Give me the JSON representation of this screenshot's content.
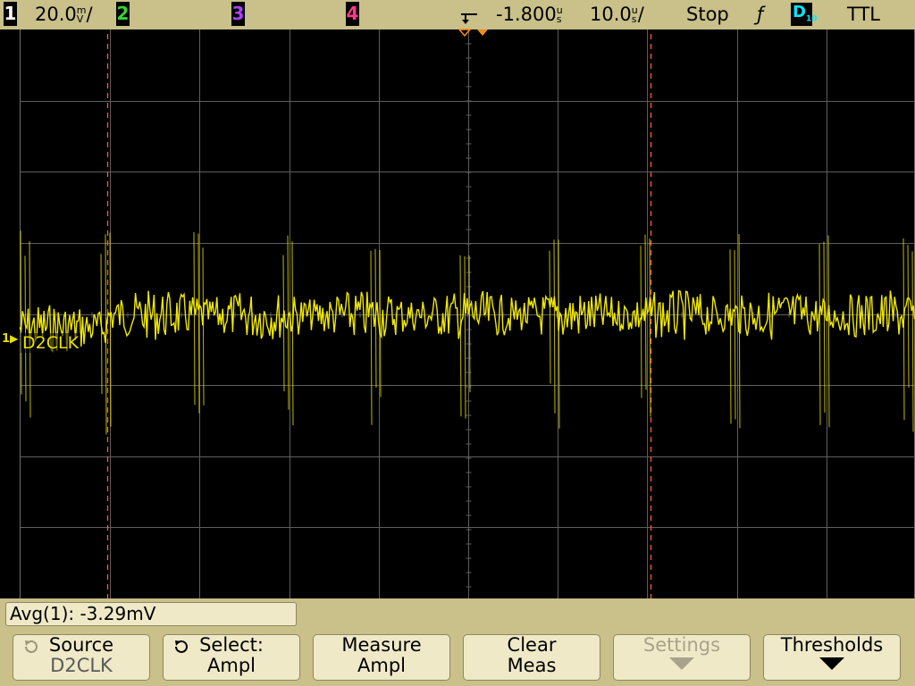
{
  "status": {
    "ch1_num": "1",
    "ch1_scale": "20.0",
    "ch1_unit_top": "m",
    "ch1_unit_bottom": "V",
    "ch1_suffix": "/",
    "ch2_num": "2",
    "ch3_num": "3",
    "ch4_num": "4",
    "delay": "-1.800",
    "delay_unit_top": "u",
    "delay_unit_bottom": "s",
    "timebase": "10.0",
    "timebase_unit_top": "u",
    "timebase_unit_bottom": "s",
    "timebase_suffix": "/",
    "run_state": "Stop",
    "trigger_slope_symbol": "ƒ",
    "digital_label": "D",
    "digital_sub": "10",
    "threshold": "TTL"
  },
  "colors": {
    "ch1": "#f0e800",
    "ch2": "#35d435",
    "ch3": "#b040ff",
    "ch4": "#ff3a8c",
    "digital": "#00e8ff",
    "grid": "#5e5e5e",
    "marker": "#ff5a36",
    "trigger": "#ff8c1a"
  },
  "trace": {
    "channel_marker": "1",
    "label": "D2CLK"
  },
  "measurement": {
    "readout": "Avg(1): -3.29mV"
  },
  "softkeys": [
    {
      "line1": "Source",
      "line2": "D2CLK",
      "icon": "knob-icon"
    },
    {
      "line1": "Select:",
      "line2": "Ampl",
      "icon": "knob-icon"
    },
    {
      "line1": "Measure",
      "line2": "Ampl"
    },
    {
      "line1": "Clear",
      "line2": "Meas"
    },
    {
      "line1": "Settings",
      "icon": "down-arrow-icon"
    },
    {
      "line1": "Thresholds",
      "icon": "down-arrow-icon"
    }
  ]
}
